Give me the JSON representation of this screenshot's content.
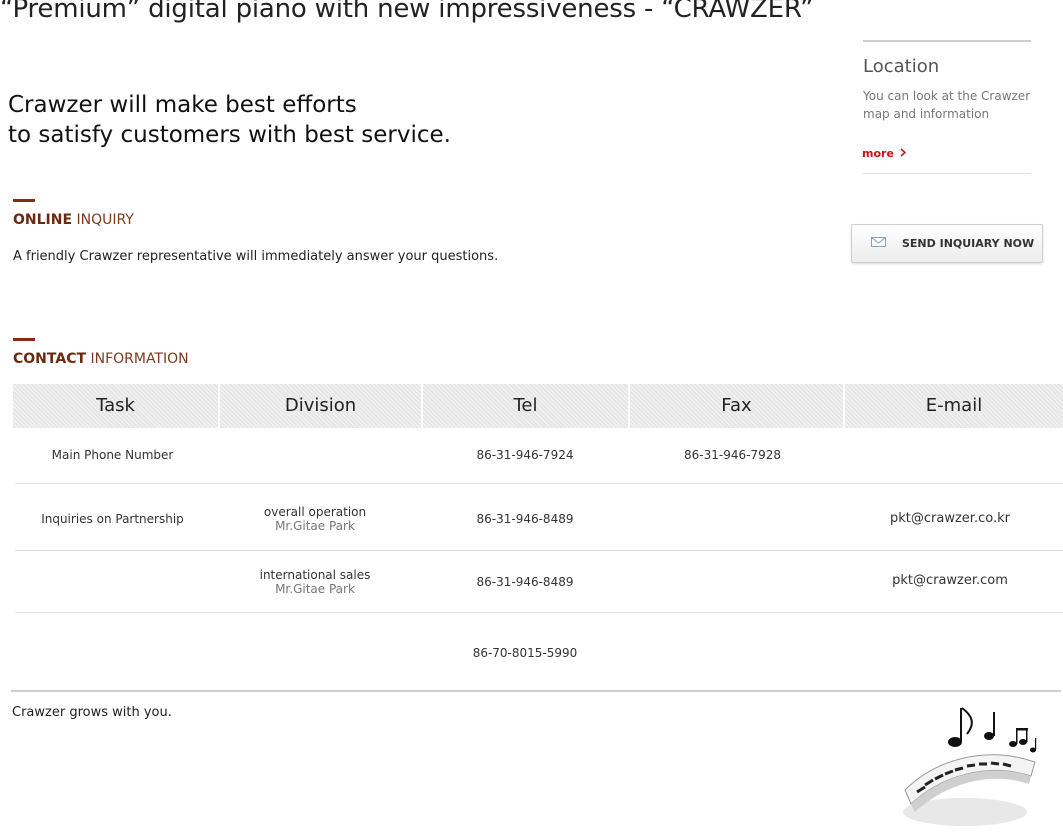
{
  "header": {
    "tagline": "“Premium” digital piano with new impressiveness - “CRAWZER”",
    "lead_line1": "Crawzer will make best efforts",
    "lead_line2": "to satisfy customers with best service."
  },
  "location": {
    "title": "Location",
    "text": "You can look at the Crawzer map and information",
    "more_label": "more"
  },
  "online_inquiry": {
    "title_bold": "ONLINE",
    "title_rest": " INQUIRY",
    "description": "A friendly Crawzer representative will immediately answer your questions.",
    "button_label": "SEND INQUIARY NOW",
    "button_icon": "envelope-icon"
  },
  "contact": {
    "title_bold": "CONTACT",
    "title_rest": " INFORMATION",
    "columns": [
      "Task",
      "Division",
      "Tel",
      "Fax",
      "E-mail"
    ],
    "rows": [
      {
        "task": "Main Phone Number",
        "division": "",
        "division_person": "",
        "tel": "86-31-946-7924",
        "fax": "86-31-946-7928",
        "email": ""
      },
      {
        "task": "Inquiries on Partnership",
        "division": "overall operation",
        "division_person": "Mr.Gitae Park",
        "tel": "86-31-946-8489",
        "fax": "",
        "email": "pkt@crawzer.co.kr"
      },
      {
        "task": "",
        "division": "international sales",
        "division_person": "Mr.Gitae Park",
        "tel": "86-31-946-8489",
        "fax": "",
        "email": "pkt@crawzer.com"
      },
      {
        "task": "",
        "division": "",
        "division_person": "",
        "tel": "86-70-8015-5990",
        "fax": "",
        "email": ""
      }
    ]
  },
  "footer": {
    "text": "Crawzer grows with you.",
    "image_icon": "piano-keyboard-notes-icon"
  },
  "colors": {
    "accent": "#8a2a10",
    "more_link": "#cc1111"
  }
}
